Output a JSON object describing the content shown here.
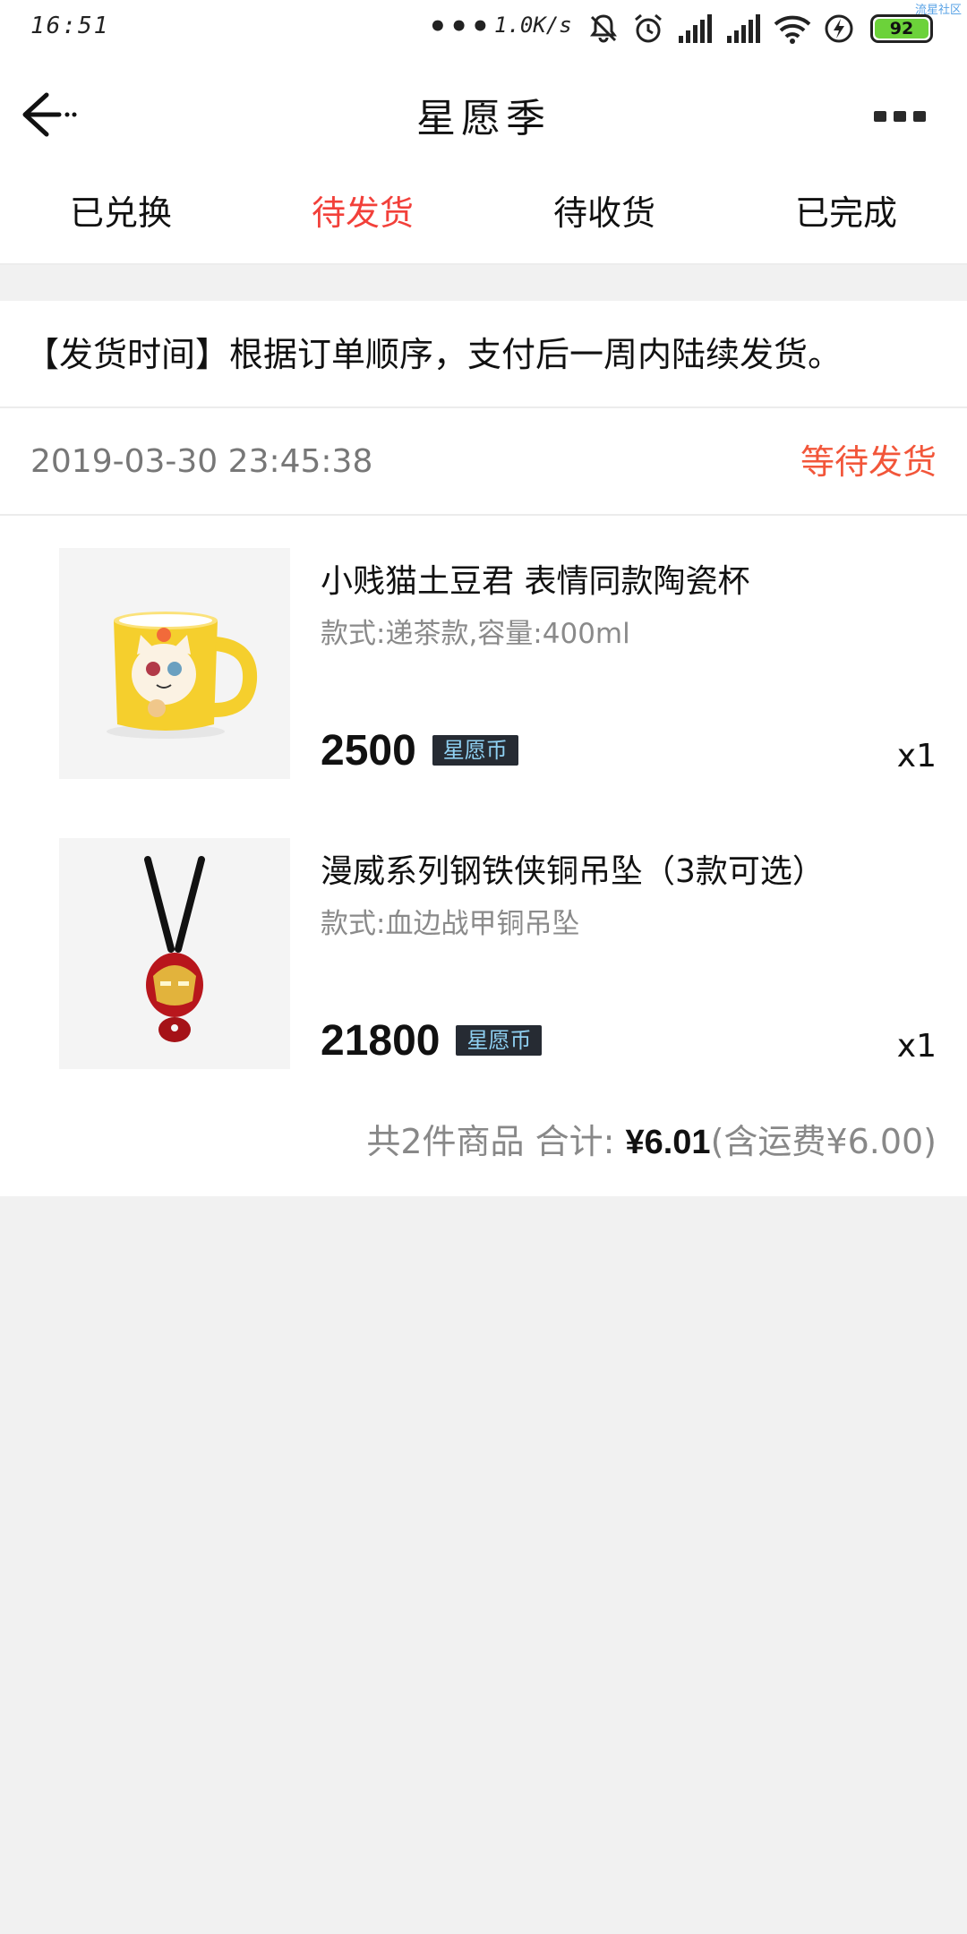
{
  "status_bar": {
    "time": "16:51",
    "dots": "•••",
    "speed": "1.0K/s",
    "battery": "92",
    "watermark": "流星社区",
    "icons": [
      "mute-icon",
      "alarm-icon",
      "signal-icon",
      "signal-icon",
      "wifi-icon",
      "charging-icon",
      "battery-icon"
    ],
    "battery_color": "#6cd23a"
  },
  "header": {
    "title": "星愿季",
    "back_icon": "back-arrow-icon",
    "more_icon": "more-icon"
  },
  "tabs": [
    {
      "label": "已兑换",
      "active": false
    },
    {
      "label": "待发货",
      "active": true
    },
    {
      "label": "待收货",
      "active": false
    },
    {
      "label": "已完成",
      "active": false
    }
  ],
  "notice": {
    "text": "【发货时间】根据订单顺序，支付后一周内陆续发货。"
  },
  "order": {
    "time": "2019-03-30 23:45:38",
    "status": "等待发货",
    "items": [
      {
        "name": "小贱猫土豆君 表情同款陶瓷杯",
        "spec": "款式:递茶款,容量:400ml",
        "price": "2500",
        "currency": "星愿币",
        "qty": "x1",
        "image": "yellow-cat-mug"
      },
      {
        "name": "漫威系列钢铁侠铜吊坠（3款可选）",
        "spec": "款式:血边战甲铜吊坠",
        "price": "21800",
        "currency": "星愿币",
        "qty": "x1",
        "image": "iron-man-pendant"
      }
    ],
    "summary": {
      "count_text": "共2件商品 合计: ",
      "total": "¥6.01",
      "shipping": "(含运费¥6.00)"
    }
  },
  "colors": {
    "accent_red": "#f2403a",
    "status_orange": "#f2563a",
    "badge_bg": "#262b33",
    "badge_text": "#8fd0f2"
  }
}
